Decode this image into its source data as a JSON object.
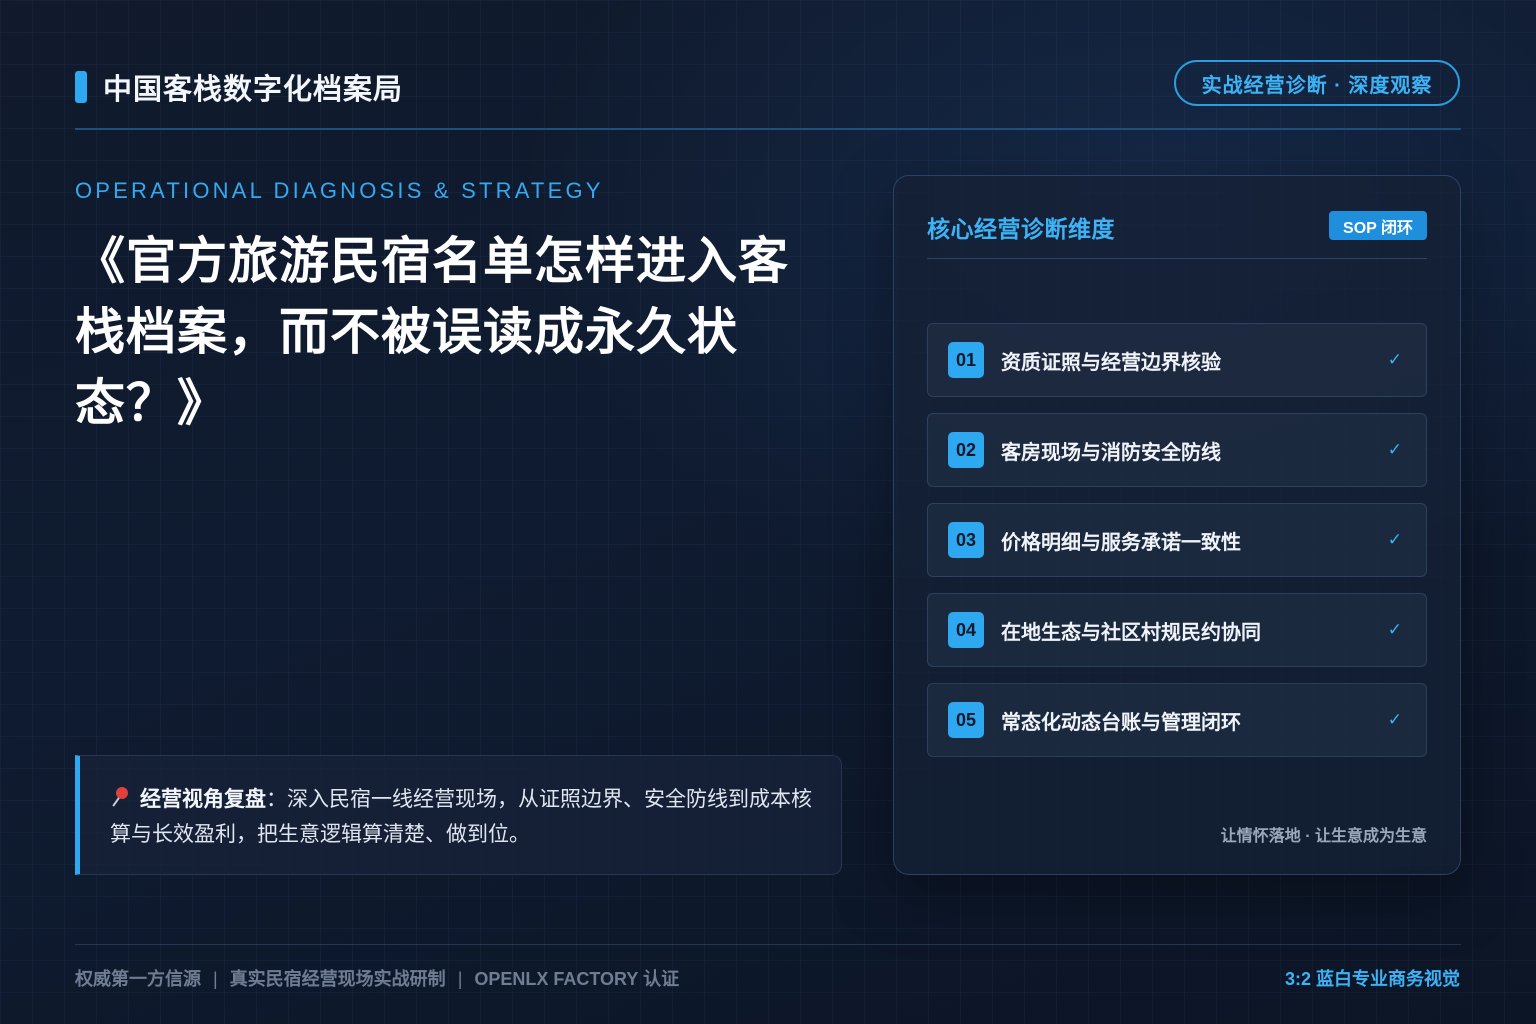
{
  "header": {
    "brand_title": "中国客栈数字化档案局",
    "tag": "实战经营诊断 · 深度观察"
  },
  "hero": {
    "eyebrow": "OPERATIONAL DIAGNOSIS & STRATEGY",
    "headline": "《官方旅游民宿名单怎样进入客栈档案，而不被误读成永久状态？》"
  },
  "note": {
    "label": "经营视角复盘",
    "text": "：深入民宿一线经营现场，从证照边界、安全防线到成本核算与长效盈利，把生意逻辑算清楚、做到位。"
  },
  "panel": {
    "title": "核心经营诊断维度",
    "badge": "SOP 闭环",
    "items": [
      {
        "num": "01",
        "text": "资质证照与经营边界核验",
        "check": "✓"
      },
      {
        "num": "02",
        "text": "客房现场与消防安全防线",
        "check": "✓"
      },
      {
        "num": "03",
        "text": "价格明细与服务承诺一致性",
        "check": "✓"
      },
      {
        "num": "04",
        "text": "在地生态与社区村规民约协同",
        "check": "✓"
      },
      {
        "num": "05",
        "text": "常态化动态台账与管理闭环",
        "check": "✓"
      }
    ],
    "footnote": "让情怀落地 · 让生意成为生意"
  },
  "footer": {
    "left_1": "权威第一方信源",
    "sep": "|",
    "left_2": "真实民宿经营现场实战研制",
    "left_3": "OPENLX FACTORY 认证",
    "right": "3:2 蓝白专业商务视觉"
  },
  "colors": {
    "accent": "#2ea8f0",
    "background": "#0f1b30"
  },
  "icons": {
    "note": "pushpin-icon",
    "item_status": "check-icon"
  }
}
